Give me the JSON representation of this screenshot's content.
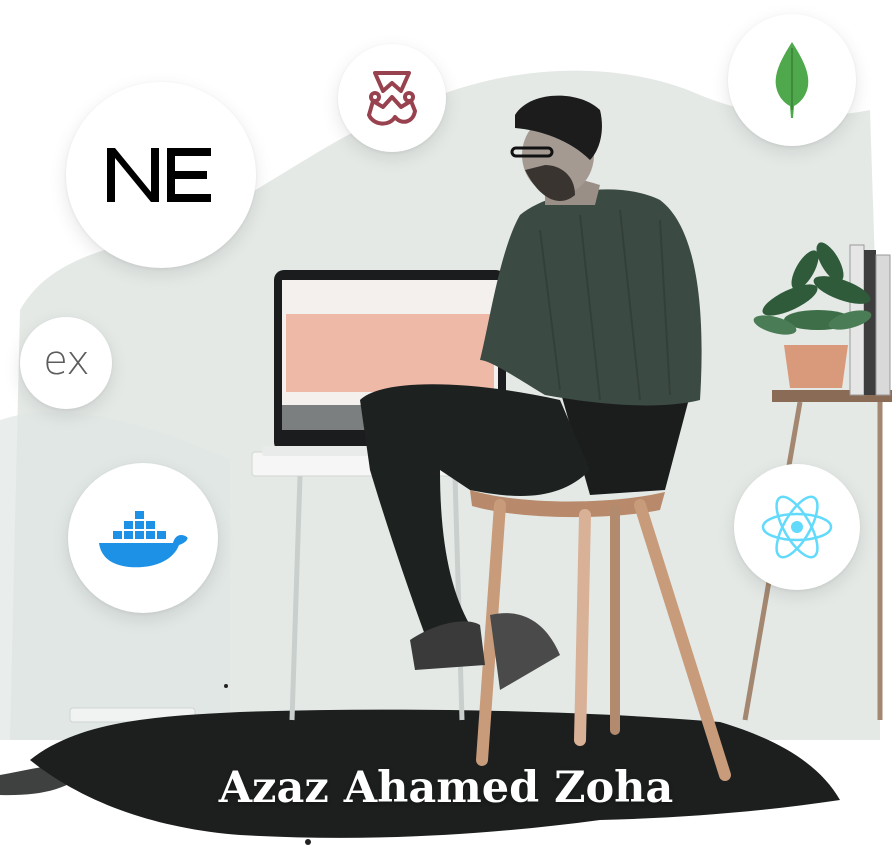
{
  "person": {
    "name": "Azaz Ahamed Zoha"
  },
  "tech_badges": [
    {
      "icon": "next-js-icon",
      "label": "NE"
    },
    {
      "icon": "jest-icon"
    },
    {
      "icon": "mongodb-icon"
    },
    {
      "icon": "express-icon",
      "label": "ex"
    },
    {
      "icon": "docker-icon"
    },
    {
      "icon": "react-icon"
    }
  ],
  "colors": {
    "background": "#ffffff",
    "wall": "#e3e8e5",
    "floor_shadow": "#1d1f1f",
    "jacket": "#3b4a42",
    "jest": "#99424f",
    "mongodb": "#4fa94c",
    "docker": "#1d91e6",
    "react": "#61dafb"
  }
}
